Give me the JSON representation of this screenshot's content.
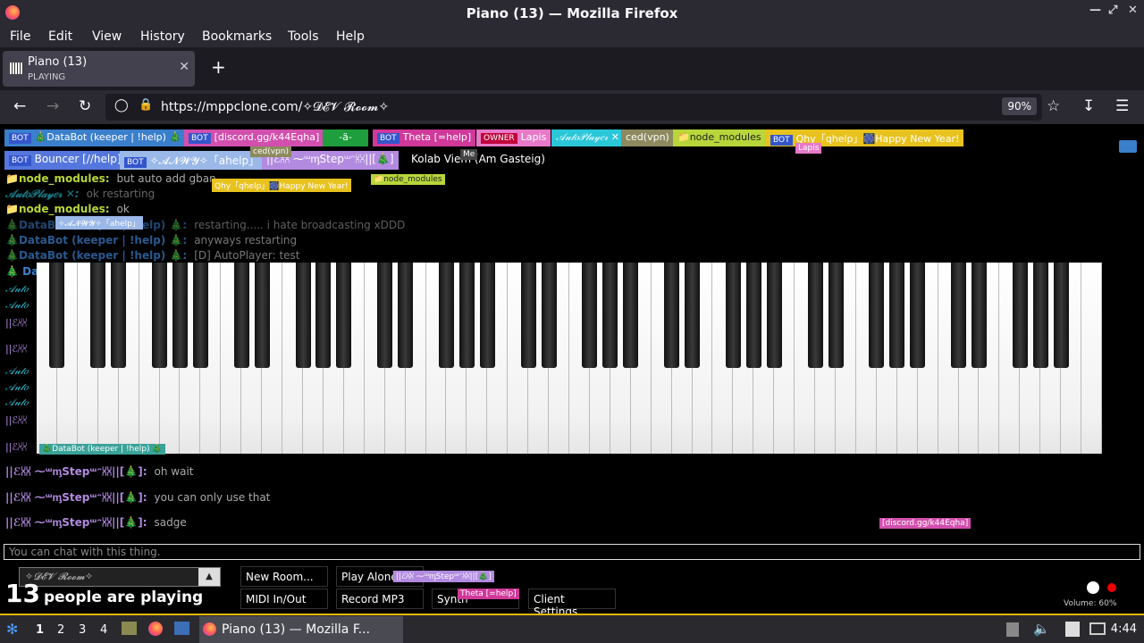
{
  "window": {
    "title": "Piano (13) — Mozilla Firefox"
  },
  "menu": [
    "File",
    "Edit",
    "View",
    "History",
    "Bookmarks",
    "Tools",
    "Help"
  ],
  "tab": {
    "title": "Piano (13)",
    "subtitle": "PLAYING"
  },
  "address": {
    "url": "https://mppclone.com/✧𝓓𝓔𝓥 𝓡𝓸𝓸𝓶✧",
    "zoom": "90%"
  },
  "users_row1": [
    {
      "badge": "BOT",
      "name": "🎄DataBot (keeper | !help) 🎄",
      "color": "#3a7fcc"
    },
    {
      "badge": "BOT",
      "name": "[discord.gg/k44Eqha]",
      "color": "#d24fae"
    },
    {
      "badge": "",
      "name": "-ä-",
      "color": "#1e9e3c"
    },
    {
      "badge": "BOT",
      "name": "Theta [=help]",
      "color": "#d0389a"
    },
    {
      "badge": "OWNER",
      "name": "Lapis",
      "color": "#e879c8"
    },
    {
      "badge": "",
      "name": "𝒜𝓊𝓉𝑜𝒫𝓁𝒶𝓎𝑒𝓇 ✕",
      "color": "#2ac7d9"
    },
    {
      "badge": "",
      "name": "ced(vpn)",
      "color": "#8c8a5e"
    },
    {
      "badge": "",
      "name": "📁node_modules",
      "color": "#b8d63a"
    },
    {
      "badge": "BOT",
      "name": "Qhy「qhelp」🎆Happy New Year!",
      "color": "#e8c21e"
    }
  ],
  "users_row2": [
    {
      "badge": "BOT",
      "name": "Bouncer [//help]",
      "color": "#5577dd"
    },
    {
      "badge": "BOT",
      "name": "✧𝓐𝓝𝓦𝓨✧「ahelp」",
      "color": "#9ab8e8"
    },
    {
      "badge": "",
      "name": "||ℰ⩆⩆ ⁓ᵚᶆStepᵚᵔ⩆⩆||[🎄]",
      "color": "#b28ae0"
    },
    {
      "badge": "",
      "name": "Kolab Viem (Am Gasteig)",
      "color": "#000000"
    }
  ],
  "cursor_labels": [
    {
      "text": "ced(vpn)",
      "color": "#8c8a5e"
    },
    {
      "text": "Me",
      "color": "#444444"
    },
    {
      "text": "Lapis",
      "color": "#e879c8"
    },
    {
      "text": "Qhy「qhelp」🎆Happy New Year!",
      "color": "#e8c21e"
    },
    {
      "text": "📁node_modules",
      "color": "#b8d63a"
    },
    {
      "text": "✧𝓐𝓝𝓦𝓨✧「ahelp」",
      "color": "#9ab8e8"
    },
    {
      "text": "🎄DataBot (keeper | !help) 🎄",
      "color": "#3aa39a"
    },
    {
      "text": "[discord.gg/k44Eqha]",
      "color": "#d24fae"
    },
    {
      "text": "||ℰ⩆⩆ ⁓ᵚᶆStepᵚᵔ⩆⩆||[🎄]",
      "color": "#b28ae0"
    },
    {
      "text": "Theta [=help]",
      "color": "#d0389a"
    }
  ],
  "chat": [
    {
      "who": "📁node_modules:",
      "msg": "but auto add gban",
      "color": "#b8d63a"
    },
    {
      "who": "𝒜𝓊𝓉𝑜𝒫𝓁𝒶𝓎𝑒𝓇 ✕:",
      "msg": "ok restarting",
      "color": "#2ac7d9"
    },
    {
      "who": "📁node_modules:",
      "msg": "ok",
      "color": "#b8d63a"
    },
    {
      "who": "🎄DataBot (keeper | !help) 🎄:",
      "msg": "restarting..... i hate broadcasting xDDD",
      "color": "#3a7fcc"
    },
    {
      "who": "🎄DataBot (keeper | !help) 🎄:",
      "msg": "anyways restarting",
      "color": "#3a7fcc"
    },
    {
      "who": "🎄DataBot (keeper | !help) 🎄:",
      "msg": "[D] AutoPlayer: test",
      "color": "#3a7fcc"
    },
    {
      "who": "||ℰ⩆⩆ ⁓ᵚᶆStepᵚᵔ⩆⩆||[🎄]:",
      "msg": "oh wait",
      "color": "#b28ae0"
    },
    {
      "who": "||ℰ⩆⩆ ⁓ᵚᶆStepᵚᵔ⩆⩆||[🎄]:",
      "msg": "you can only use that",
      "color": "#b28ae0"
    },
    {
      "who": "||ℰ⩆⩆ ⁓ᵚᶆStepᵚᵔ⩆⩆||[🎄]:",
      "msg": "sadge",
      "color": "#b28ae0"
    }
  ],
  "chat_partial": [
    "🎄 Da",
    "𝒜𝓊𝓉𝑜",
    "𝒜𝓊𝓉𝑜",
    "||ℰ⩆⩆",
    "||ℰ⩆⩆",
    "𝒜𝓊𝓉𝑜",
    "𝒜𝓊𝓉𝑜",
    "𝒜𝓊𝓉𝑜",
    "||ℰ⩆⩆",
    "||ℰ⩆⩆"
  ],
  "chat_input": {
    "placeholder": "You can chat with this thing."
  },
  "controls": {
    "room": "✧𝓓𝓔𝓥 𝓡𝓸𝓸𝓶✧",
    "new_room": "New Room...",
    "play_alone": "Play Alone",
    "midi": "MIDI In/Out",
    "record": "Record MP3",
    "synth": "Synth",
    "client_settings": "Client Settings",
    "volume": "Volume: 60%"
  },
  "people": {
    "count": "13",
    "label": "people are playing"
  },
  "taskbar": {
    "workspaces": [
      "1",
      "2",
      "3",
      "4"
    ],
    "app": "Piano (13) — Mozilla F...",
    "clock": "4:44"
  }
}
